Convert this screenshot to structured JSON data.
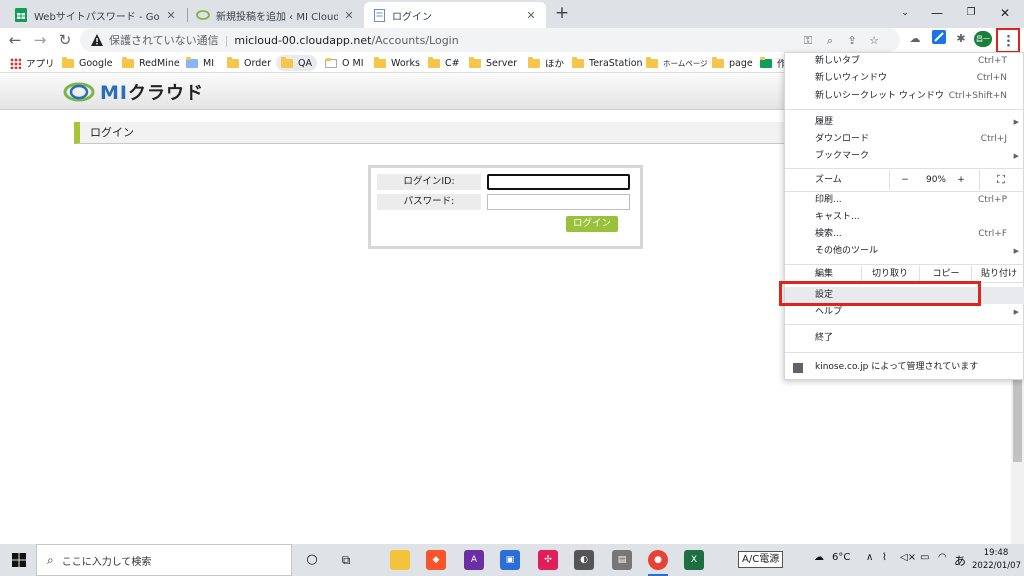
{
  "tabs": [
    {
      "title": "Webサイトパスワード - Google スプレ",
      "icon": "sheets-icon"
    },
    {
      "title": "新規投稿を追加 ‹ MI Cloud(印刷",
      "icon": "mi-cloud-icon"
    },
    {
      "title": "ログイン",
      "icon": "page-icon"
    }
  ],
  "toolbar": {
    "security_label": "保護されていない通信",
    "url_host": "micloud-00.cloudapp.net",
    "url_path": "/Accounts/Login",
    "profile_label": "昌一"
  },
  "bookmarks": [
    "アプリ",
    "Google",
    "RedMine",
    "MI",
    "Order",
    "QA",
    "O MI",
    "Works",
    "C#",
    "Server",
    "ほか",
    "TeraStation",
    "ホームページ",
    "page",
    "作"
  ],
  "page": {
    "logo_text": "MI",
    "logo_kana": "クラウド",
    "section_title": "ログイン",
    "login_id_label": "ログインID:",
    "password_label": "パスワード:",
    "login_button": "ログイン"
  },
  "menu": {
    "new_tab": "新しいタブ",
    "new_tab_sc": "Ctrl+T",
    "new_window": "新しいウィンドウ",
    "new_window_sc": "Ctrl+N",
    "incognito": "新しいシークレット ウィンドウ",
    "incognito_sc": "Ctrl+Shift+N",
    "history": "履歴",
    "downloads": "ダウンロード",
    "downloads_sc": "Ctrl+J",
    "bookmarks": "ブックマーク",
    "zoom": "ズーム",
    "zoom_minus": "−",
    "zoom_value": "90%",
    "zoom_plus": "+",
    "print": "印刷...",
    "print_sc": "Ctrl+P",
    "cast": "キャスト...",
    "find": "検索...",
    "find_sc": "Ctrl+F",
    "more_tools": "その他のツール",
    "edit": "編集",
    "cut": "切り取り",
    "copy": "コピー",
    "paste": "貼り付け",
    "settings": "設定",
    "help": "ヘルプ",
    "exit": "終了",
    "managed": "kinose.co.jp によって管理されています"
  },
  "taskbar": {
    "search_placeholder": "ここに入力して検索",
    "ime": "A/C電源",
    "temperature": "6°C",
    "ime_mode": "あ",
    "time": "19:48",
    "date": "2022/01/07"
  },
  "colors": {
    "highlight_red": "#e0231c",
    "accent_green": "#9ac13c",
    "logo_blue": "#2a6fb5"
  }
}
